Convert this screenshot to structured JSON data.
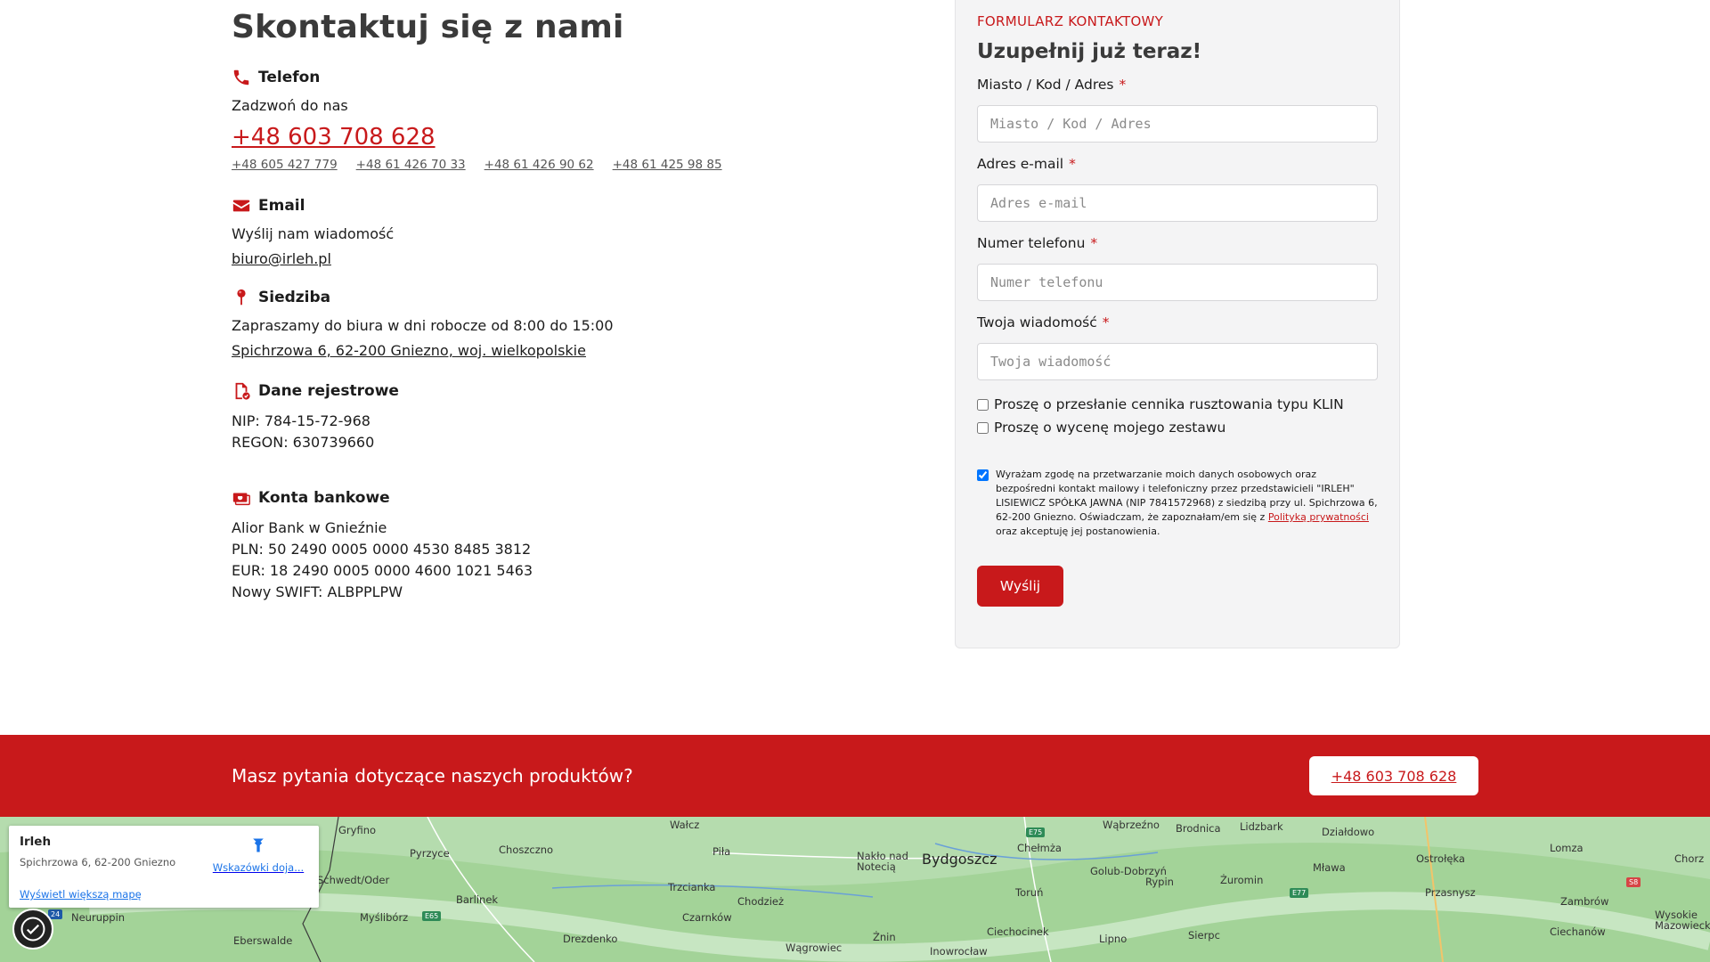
{
  "contact": {
    "title": "Skontaktuj się z nami",
    "phone": {
      "heading": "Telefon",
      "subtitle": "Zadzwoń do nas",
      "main": "+48 603 708 628",
      "others": [
        "+48 605 427 779",
        "+48 61 426 70 33",
        "+48 61 426 90 62",
        "+48 61 425 98 85"
      ]
    },
    "email": {
      "heading": "Email",
      "subtitle": "Wyślij nam wiadomość",
      "address": "biuro@irleh.pl"
    },
    "office": {
      "heading": "Siedziba",
      "subtitle": "Zapraszamy do biura w dni robocze od 8:00 do 15:00",
      "address": "Spichrzowa 6, 62-200 Gniezno, woj. wielkopolskie"
    },
    "registry": {
      "heading": "Dane rejestrowe",
      "nip": "NIP: 784-15-72-968",
      "regon": "REGON: 630739660"
    },
    "bank": {
      "heading": "Konta bankowe",
      "name": "Alior Bank w Gnieźnie",
      "pln": "PLN: 50 2490 0005 0000 4530 8485 3812",
      "eur": "EUR: 18 2490 0005 0000 4600 1021 5463",
      "swift": "Nowy SWIFT: ALBPPLPW"
    }
  },
  "form": {
    "kicker": "FORMULARZ KONTAKTOWY",
    "title": "Uzupełnij już teraz!",
    "required_mark": "*",
    "fields": [
      {
        "label": "Miasto / Kod / Adres",
        "placeholder": "Miasto / Kod / Adres",
        "value": ""
      },
      {
        "label": "Adres e-mail",
        "placeholder": "Adres e-mail",
        "value": ""
      },
      {
        "label": "Numer telefonu",
        "placeholder": "Numer telefonu",
        "value": ""
      },
      {
        "label": "Twoja wiadomość",
        "placeholder": "Twoja wiadomość",
        "value": ""
      }
    ],
    "checkboxes": [
      {
        "label": "Proszę o przesłanie cennika rusztowania typu KLIN",
        "checked": false
      },
      {
        "label": "Proszę o wycenę mojego zestawu",
        "checked": false
      }
    ],
    "consent": {
      "checked": true,
      "text": "Wyrażam zgodę na przetwarzanie moich danych osobowych oraz bezpośredni kontakt mailowy i telefoniczny przez przedstawicieli \"IRLEH\" LISIEWICZ SPÓŁKA JAWNA (NIP 7841572968) z siedzibą przy ul. Spichrzowa 6, 62-200 Gniezno. Oświadczam, że zapoznałam/em się z",
      "link": "Polityką prywatności",
      "suffix": "oraz akceptuję jej postanowienia."
    },
    "submit_label": "Wyślij"
  },
  "cta": {
    "text": "Masz pytania dotyczące naszych produktów?",
    "button": "+48 603 708 628"
  },
  "map": {
    "place_name": "Irleh",
    "place_address": "Spichrzowa 6, 62-200 Gniezno",
    "directions_label": "Wskazówki doja...",
    "larger_map_link": "Wyświetl większą mapę",
    "labels": [
      "Gryfino",
      "Pyrzyce",
      "Choszczno",
      "Wałcz",
      "Piła",
      "Nakło nad Notecią",
      "Bydgoszcz",
      "Chełmża",
      "Wąbrzeźno",
      "Brodnica",
      "Lidzbark",
      "Działdowo",
      "Lomza",
      "Chorz",
      "Schwedt/Oder",
      "Barlinek",
      "Trzcianka",
      "Chodzież",
      "Toruń",
      "Golub-Dobrzyń",
      "Rypin",
      "Żuromin",
      "Mława",
      "Ostrołęka",
      "Przasnysz",
      "Zambrów",
      "Myślibórz",
      "Czarnków",
      "Ciechocinek",
      "Neuruppin",
      "Eberswalde",
      "Drezdenko",
      "Żnin",
      "Wągrowiec",
      "Inowrocław",
      "Lipno",
      "Sierpc",
      "Ciechanów",
      "Wysokie Mazowieckie"
    ],
    "road_badges": [
      "E75",
      "E77",
      "E65",
      "S8",
      "24"
    ]
  }
}
